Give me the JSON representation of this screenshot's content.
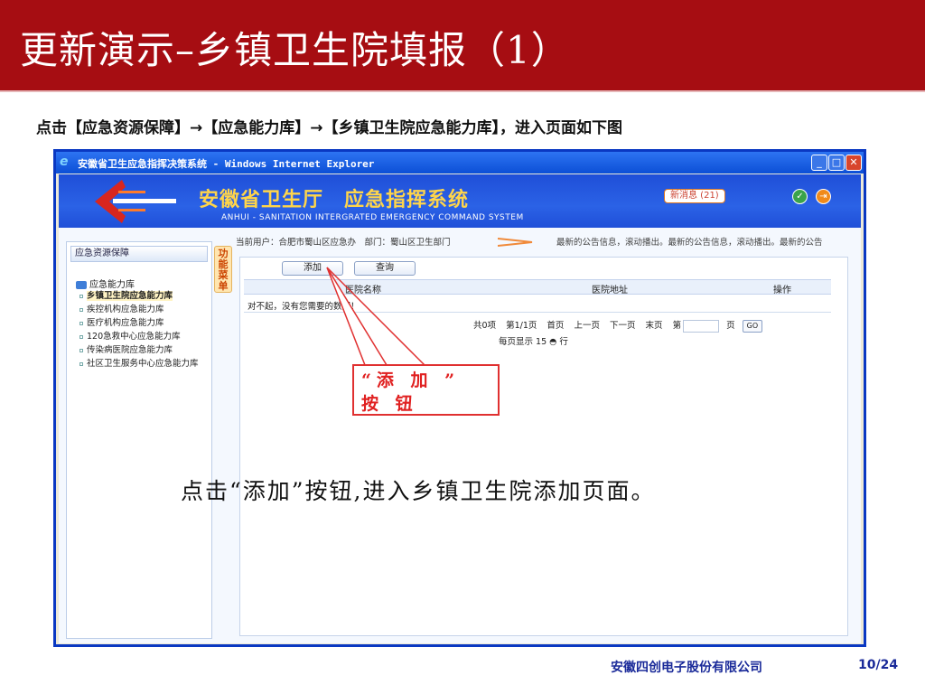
{
  "slide": {
    "title": "更新演示–乡镇卫生院填报（1）",
    "instruction": "点击【应急资源保障】→【应急能力库】→【乡镇卫生院应急能力库】，进入页面如下图",
    "note": "点击“添加”按钮,进入乡镇卫生院添加页面。",
    "callout": "“添 加 ” 按 钮",
    "footer_company": "安徽四创电子股份有限公司",
    "footer_page": "10/24",
    "colors": {
      "title_bg": "#a60d12",
      "callout": "#e02020",
      "footer_text": "#1a2a99"
    }
  },
  "window": {
    "title": "安徽省卫生应急指挥决策系统 - Windows Internet Explorer",
    "icon": "ie-icon",
    "controls": {
      "minimize": "_",
      "maximize": "□",
      "close": "✕"
    }
  },
  "app": {
    "name": "安徽省卫生厅　应急指挥系统",
    "subtitle": "ANHUI - SANITATION INTERGRATED EMERGENCY COMMAND SYSTEM",
    "new_messages": "新消息 (21)"
  },
  "sidebar": {
    "header": "应急资源保障",
    "root": "应急能力库",
    "items": [
      {
        "label": "乡镇卫生院应急能力库",
        "active": true
      },
      {
        "label": "疾控机构应急能力库",
        "active": false
      },
      {
        "label": "医疗机构应急能力库",
        "active": false
      },
      {
        "label": "120急救中心应急能力库",
        "active": false
      },
      {
        "label": "传染病医院应急能力库",
        "active": false
      },
      {
        "label": "社区卫生服务中心应急能力库",
        "active": false
      }
    ],
    "func_tab": "功能菜单"
  },
  "main": {
    "current_user": "当前用户：合肥市蜀山区应急办　部门：蜀山区卫生部门",
    "ticker": "最新的公告信息，滚动播出。最新的公告信息，滚动播出。最新的公告",
    "buttons": {
      "add": "添加",
      "query": "查询"
    },
    "columns": [
      "医院名称",
      "医院地址",
      "操作"
    ],
    "empty_message": "对不起，没有您需要的数据！",
    "pager": {
      "total": "共0项",
      "page": "第1/1页",
      "first": "首页",
      "prev": "上一页",
      "next": "下一页",
      "last": "末页",
      "goto_prefix": "第",
      "goto_suffix": "页",
      "go": "GO"
    },
    "per_page": "每页显示 15 ◓ 行"
  }
}
